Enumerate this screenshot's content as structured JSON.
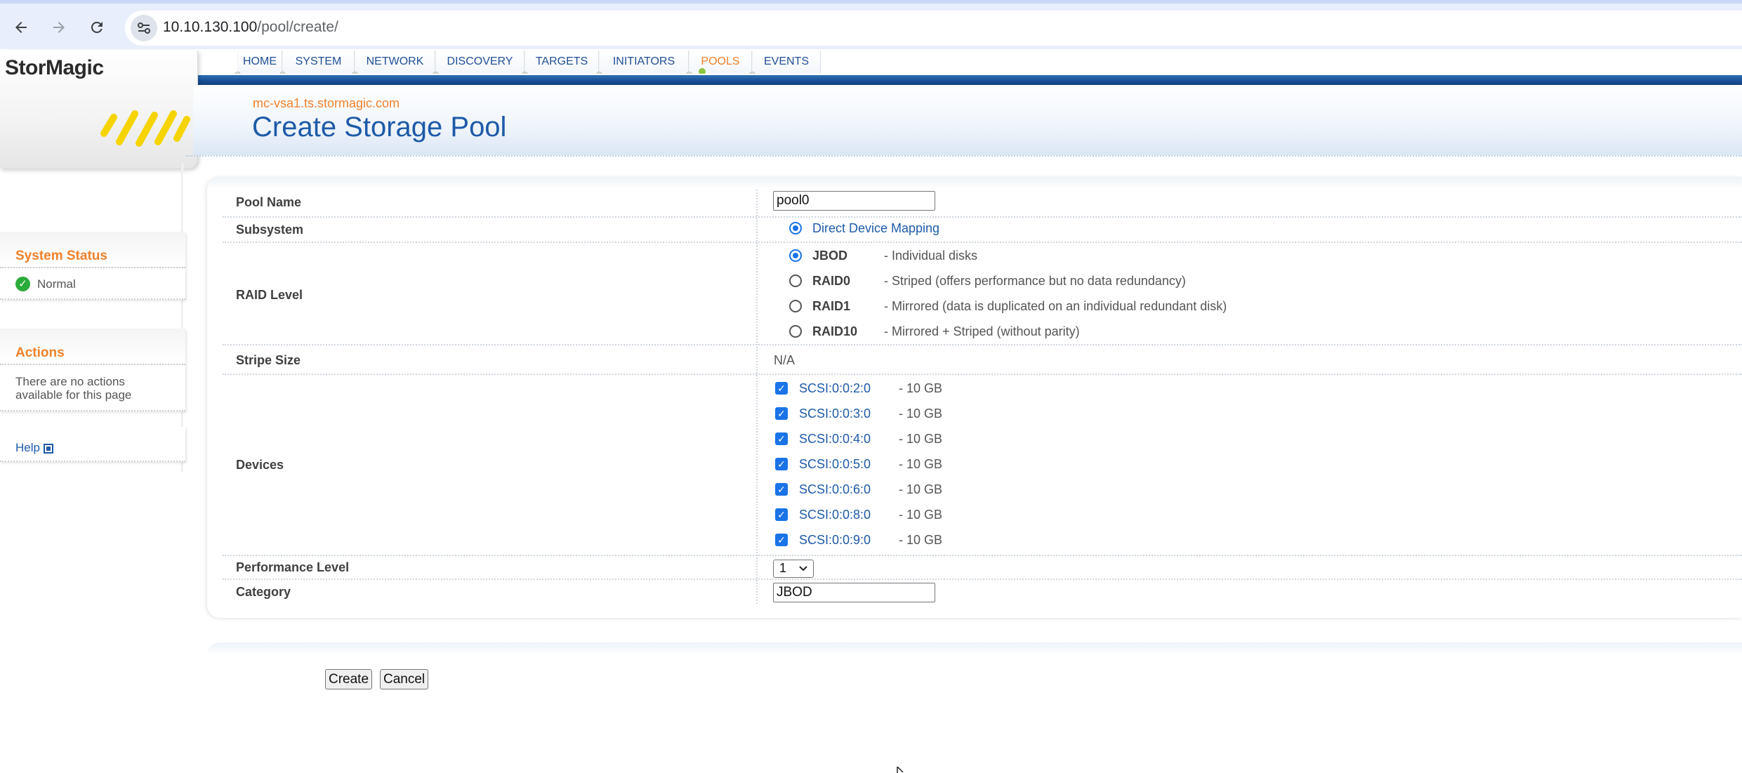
{
  "browser": {
    "url_host": "10.10.130.100",
    "url_path": "/pool/create/"
  },
  "brand": {
    "name": "StorMagic"
  },
  "nav": {
    "tabs": [
      {
        "label": "HOME"
      },
      {
        "label": "SYSTEM"
      },
      {
        "label": "NETWORK"
      },
      {
        "label": "DISCOVERY"
      },
      {
        "label": "TARGETS"
      },
      {
        "label": "INITIATORS"
      },
      {
        "label": "POOLS"
      },
      {
        "label": "EVENTS"
      }
    ],
    "active": "POOLS"
  },
  "header": {
    "host": "mc-vsa1.ts.stormagic.com",
    "title": "Create Storage Pool"
  },
  "sidebar": {
    "status_title": "System Status",
    "status_value": "Normal",
    "actions_title": "Actions",
    "actions_text": "There are no actions available for this page",
    "help_label": "Help"
  },
  "form": {
    "pool_name_label": "Pool Name",
    "pool_name_value": "pool0",
    "subsystem_label": "Subsystem",
    "subsystem_value": "Direct Device Mapping",
    "raid_label": "RAID Level",
    "raid_options": [
      {
        "name": "JBOD",
        "desc": "- Individual disks",
        "checked": true
      },
      {
        "name": "RAID0",
        "desc": "- Striped (offers performance but no data redundancy)",
        "checked": false
      },
      {
        "name": "RAID1",
        "desc": "- Mirrored (data is duplicated on an individual redundant disk)",
        "checked": false
      },
      {
        "name": "RAID10",
        "desc": "- Mirrored + Striped (without parity)",
        "checked": false
      }
    ],
    "stripe_label": "Stripe Size",
    "stripe_value": "N/A",
    "devices_label": "Devices",
    "devices": [
      {
        "id": "SCSI:0:0:2:0",
        "size": "- 10 GB",
        "checked": true
      },
      {
        "id": "SCSI:0:0:3:0",
        "size": "- 10 GB",
        "checked": true
      },
      {
        "id": "SCSI:0:0:4:0",
        "size": "- 10 GB",
        "checked": true
      },
      {
        "id": "SCSI:0:0:5:0",
        "size": "- 10 GB",
        "checked": true
      },
      {
        "id": "SCSI:0:0:6:0",
        "size": "- 10 GB",
        "checked": true
      },
      {
        "id": "SCSI:0:0:8:0",
        "size": "- 10 GB",
        "checked": true
      },
      {
        "id": "SCSI:0:0:9:0",
        "size": "- 10 GB",
        "checked": true
      }
    ],
    "performance_label": "Performance Level",
    "performance_value": "1",
    "category_label": "Category",
    "category_value": "JBOD"
  },
  "buttons": {
    "create": "Create",
    "cancel": "Cancel"
  },
  "colors": {
    "accent_orange": "#f0812a",
    "link_blue": "#1d5aa8",
    "nav_blue": "#1a4f96"
  },
  "icons": [
    "back-arrow-icon",
    "forward-arrow-icon",
    "reload-icon",
    "site-info-icon",
    "check-circle-icon",
    "external-link-icon",
    "chevron-down-icon"
  ]
}
